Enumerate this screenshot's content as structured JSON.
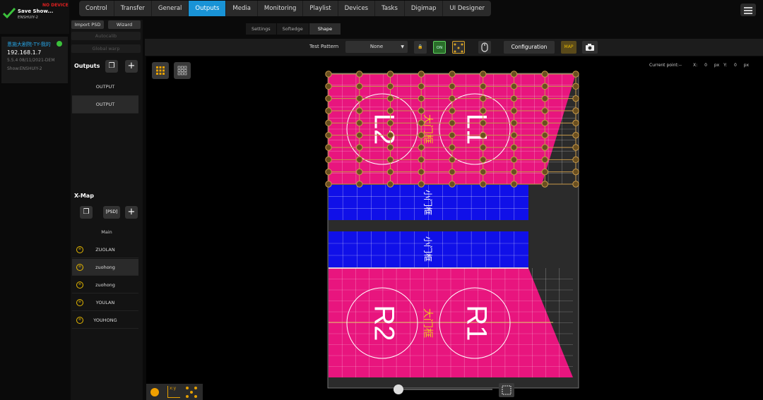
{
  "status": {
    "save_title": "Save Show...",
    "save_sub": "ENSHUIY-2",
    "no_device": "NO DEVICE"
  },
  "device": {
    "name": "恩施大剧院-TY-我的",
    "ip": "192.168.1.7",
    "version": "5.5.4 08/11/2021-DEM",
    "show": "Show:ENSHUIY-2"
  },
  "nav": {
    "tabs": [
      "Control",
      "Transfer",
      "General",
      "Outputs",
      "Media",
      "Monitoring",
      "Playlist",
      "Devices",
      "Tasks",
      "Digimap",
      "UI Designer"
    ],
    "active": "Outputs"
  },
  "left": {
    "import_psd": "Import PSD",
    "wizard": "Wizard",
    "autocalib": "Autocalib",
    "global_warp": "Global warp",
    "outputs_title": "Outputs",
    "outputs": [
      "OUTPUT",
      "OUTPUT"
    ],
    "xmap_title": "X-Map",
    "psd_label": "[PSD]",
    "main_label": "Main",
    "xmap_items": [
      "ZUOLAN",
      "zuohong",
      "zuohong",
      "YOULAN",
      "YOUHONG"
    ]
  },
  "subtabs": [
    "Settings",
    "Softedge",
    "Shape"
  ],
  "toolbar": {
    "test_pattern_label": "Test Pattern",
    "test_pattern_value": "None",
    "on_label": "ON",
    "configuration": "Configuration",
    "map_label": "MAP"
  },
  "canvas": {
    "current_point": "Current point:--",
    "x_label": "X:",
    "x_value": "0",
    "y_label": "Y:",
    "y_value": "0",
    "unit": "px"
  },
  "content": {
    "top_left_label": "L2",
    "top_right_label": "L1",
    "top_center_label": "大门框",
    "blue_label": "小门框",
    "bottom_left_label": "R2",
    "bottom_right_label": "R1",
    "bottom_center_label": "大门框"
  },
  "colors": {
    "magenta": "#e8157e",
    "blue": "#1010e8",
    "accent": "#1993d6",
    "warp_point": "#c89a4a"
  },
  "bottombar": {
    "xy_label": "x:y"
  }
}
